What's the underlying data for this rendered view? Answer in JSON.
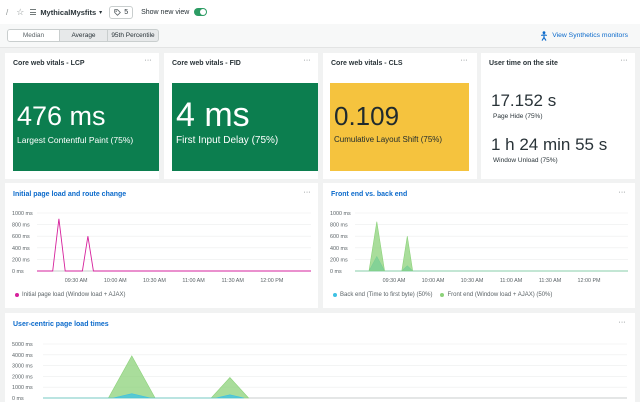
{
  "header": {
    "app_name": "MythicalMysfits",
    "tag_count": "5",
    "show_new_view": "Show new view",
    "show_new_view_on": true
  },
  "toolbar": {
    "segments": [
      {
        "label": "Median",
        "selected": true
      },
      {
        "label": "Average",
        "selected": false
      },
      {
        "label": "95th Percentile",
        "selected": false
      }
    ],
    "synthetics_link": "View Synthetics monitors"
  },
  "colors": {
    "lcp": "#0c7e4f",
    "fid": "#0c7e4f",
    "cls": "#f5c33e",
    "accent_link": "#0b6acb",
    "pink": "#d6219c",
    "cyan": "#3ec1e3",
    "green": "#8cd27a"
  },
  "cards": {
    "lcp": {
      "title": "Core web vitals - LCP",
      "value": "476 ms",
      "label": "Largest Contentful Paint (75%)"
    },
    "fid": {
      "title": "Core web vitals - FID",
      "value": "4 ms",
      "label": "First Input Delay (75%)"
    },
    "cls": {
      "title": "Core web vitals - CLS",
      "value": "0.109",
      "label": "Cumulative Layout Shift (75%)"
    },
    "user_time": {
      "title": "User time on the site",
      "page_hide_value": "17.152 s",
      "page_hide_label": "Page Hide (75%)",
      "unload_value": "1 h 24 min 55 s",
      "unload_label": "Window Unload (75%)"
    }
  },
  "chart_data": [
    {
      "type": "line",
      "title": "Initial page load and route change",
      "y_ticks": [
        "1000 ms",
        "800 ms",
        "600 ms",
        "400 ms",
        "200 ms",
        "0 ms"
      ],
      "ylim": [
        0,
        1000
      ],
      "x_ticks": [
        "09:30 AM",
        "10:00 AM",
        "10:30 AM",
        "11:00 AM",
        "11:30 AM",
        "12:00 PM"
      ],
      "x_range_minutes": [
        9.0,
        12.5
      ],
      "series": [
        {
          "name": "Initial page load (Window load + AJAX)",
          "color": "#d6219c",
          "points": [
            [
              9.0,
              0
            ],
            [
              9.2,
              0
            ],
            [
              9.28,
              900
            ],
            [
              9.36,
              0
            ],
            [
              9.58,
              0
            ],
            [
              9.65,
              600
            ],
            [
              9.72,
              0
            ],
            [
              12.5,
              0
            ]
          ]
        }
      ]
    },
    {
      "type": "area",
      "title": "Front end vs. back end",
      "y_ticks": [
        "1000 ms",
        "800 ms",
        "600 ms",
        "400 ms",
        "200 ms",
        "0 ms"
      ],
      "ylim": [
        0,
        1000
      ],
      "x_ticks": [
        "09:30 AM",
        "10:00 AM",
        "10:30 AM",
        "11:00 AM",
        "11:30 AM",
        "12:00 PM"
      ],
      "x_range_minutes": [
        9.0,
        12.5
      ],
      "series": [
        {
          "name": "Back end (Time to first byte) (50%)",
          "color": "#3ec1e3",
          "points": [
            [
              9.0,
              0
            ],
            [
              9.18,
              0
            ],
            [
              9.28,
              250
            ],
            [
              9.38,
              0
            ],
            [
              9.6,
              0
            ],
            [
              9.67,
              90
            ],
            [
              9.74,
              0
            ],
            [
              12.5,
              0
            ]
          ]
        },
        {
          "name": "Front end (Window load + AJAX) (50%)",
          "color": "#8cd27a",
          "points": [
            [
              9.0,
              0
            ],
            [
              9.18,
              0
            ],
            [
              9.28,
              850
            ],
            [
              9.38,
              0
            ],
            [
              9.6,
              0
            ],
            [
              9.67,
              600
            ],
            [
              9.74,
              0
            ],
            [
              12.5,
              0
            ]
          ]
        }
      ]
    },
    {
      "type": "area",
      "title": "User-centric page load times",
      "y_ticks": [
        "5000 ms",
        "4000 ms",
        "3000 ms",
        "2000 ms",
        "1000 ms",
        "0 ms"
      ],
      "ylim": [
        0,
        5000
      ],
      "x_range_minutes": [
        9.0,
        12.5
      ],
      "series": [
        {
          "name": "",
          "color": "#8cd27a",
          "points": [
            [
              9.0,
              0
            ],
            [
              9.28,
              0
            ],
            [
              9.38,
              3900
            ],
            [
              9.48,
              0
            ],
            [
              9.72,
              0
            ],
            [
              9.8,
              1900
            ],
            [
              9.88,
              0
            ],
            [
              12.5,
              0
            ]
          ]
        },
        {
          "name": "",
          "color": "#3ec1e3",
          "points": [
            [
              9.0,
              0
            ],
            [
              9.3,
              0
            ],
            [
              9.38,
              400
            ],
            [
              9.46,
              0
            ],
            [
              9.74,
              0
            ],
            [
              9.8,
              300
            ],
            [
              9.86,
              0
            ],
            [
              12.5,
              0
            ]
          ]
        }
      ]
    }
  ]
}
